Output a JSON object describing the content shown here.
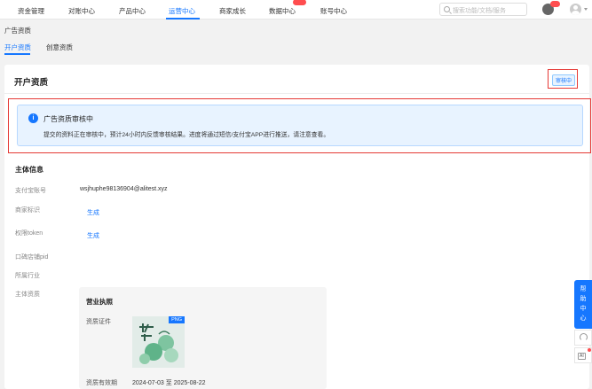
{
  "nav": {
    "items": [
      {
        "label": "资金管理"
      },
      {
        "label": "对账中心"
      },
      {
        "label": "产品中心"
      },
      {
        "label": "运营中心"
      },
      {
        "label": "商家成长"
      },
      {
        "label": "数据中心"
      },
      {
        "label": "账号中心"
      }
    ],
    "active": "运营中心",
    "search_placeholder": "搜索功能/文档/服务"
  },
  "breadcrumb": "广告资质",
  "subtabs": [
    {
      "label": "开户资质",
      "active": true
    },
    {
      "label": "创意资质",
      "active": false
    }
  ],
  "card": {
    "title": "开户资质",
    "status": "审核中"
  },
  "alert": {
    "title": "广告资质审核中",
    "text": "提交的资料正在审核中，预计24小时内反馈审核结果。进度将通过短信/支付宝APP进行推送，请注意查看。"
  },
  "info": {
    "section_title": "主体信息",
    "fields": [
      {
        "label": "支付宝账号",
        "value": "wsjhuphe98136904@alitest.xyz"
      },
      {
        "label": "商家标识",
        "link": "生成"
      },
      {
        "label": "权限token",
        "link": "生成"
      },
      {
        "label": "口碑店铺pid"
      },
      {
        "label": "所属行业"
      },
      {
        "label": "主体资质"
      }
    ]
  },
  "license": {
    "title": "营业执照",
    "cert_label": "资质证件",
    "file_tag": "PNG",
    "validity_label": "资质有效期",
    "validity": "2024-07-03 至 2025-08-22"
  },
  "help": {
    "label": [
      "帮",
      "助",
      "中",
      "心"
    ]
  },
  "side": {
    "ai_label": "AI"
  },
  "colors": {
    "accent": "#1677ff",
    "highlight": "#e53935",
    "alert_bg": "#e8f3ff"
  }
}
